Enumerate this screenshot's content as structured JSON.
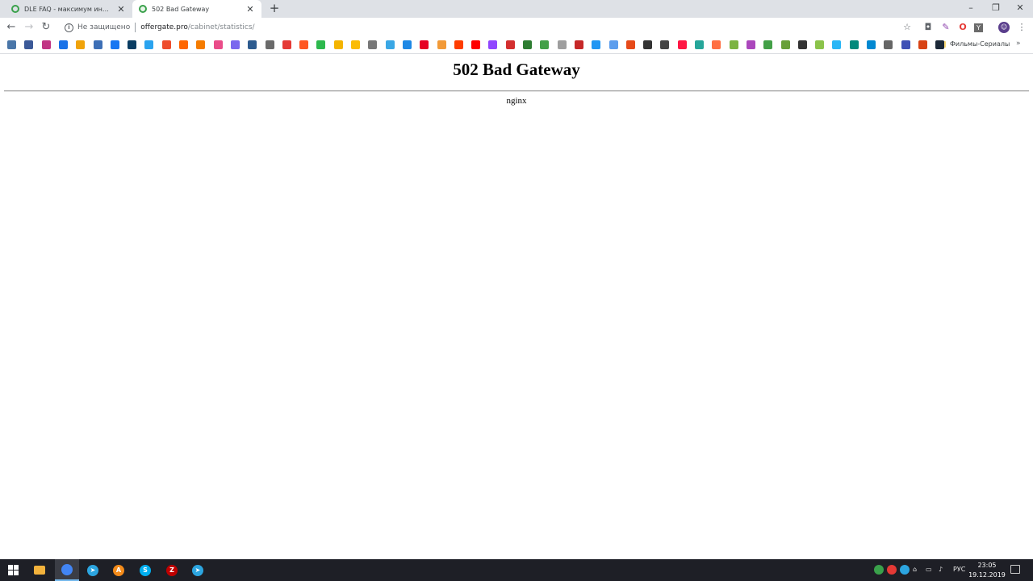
{
  "browser": {
    "tabs": [
      {
        "title": "DLE FAQ - максимум информа...",
        "close": "✕"
      },
      {
        "title": "502 Bad Gateway",
        "close": "✕"
      }
    ],
    "new_tab": "+",
    "window_controls": {
      "minimize": "–",
      "maximize": "❐",
      "close": "✕"
    },
    "nav": {
      "back": "←",
      "forward": "→",
      "reload": "↻"
    },
    "address": {
      "security_label": "Не защищено",
      "host": "offergate.pro",
      "path": "/cabinet/statistics/"
    },
    "toolbar_icons": [
      "bookmark-star-icon",
      "camera-icon",
      "pen-icon",
      "opera-icon",
      "yandex-icon",
      "profile-avatar-icon",
      "menu-kebab-icon"
    ],
    "bookmarks": {
      "icon_colors": [
        "#4a76a8",
        "#3b5998",
        "#c13584",
        "#1a73e8",
        "#f0a30a",
        "#3d6fb6",
        "#1877f2",
        "#0a3d62",
        "#2aa3ef",
        "#ee4d2d",
        "#ff6600",
        "#f57c00",
        "#ea4c89",
        "#7b68ee",
        "#2d5b8f",
        "#6a6a6a",
        "#e53935",
        "#ff5722",
        "#2db84d",
        "#f4b400",
        "#fbbc04",
        "#777777",
        "#3aa7e5",
        "#1e88e5",
        "#e60023",
        "#f29a38",
        "#ff3d00",
        "#ff0000",
        "#9146ff",
        "#d32f2f",
        "#2e7d32",
        "#43a047",
        "#9e9e9e",
        "#c62828",
        "#2196f3",
        "#5c9ded",
        "#e64a19",
        "#333333",
        "#444444",
        "#ff1744",
        "#26a69a",
        "#ff7043",
        "#7cb342",
        "#ab47bc",
        "#43a047",
        "#689f38",
        "#333333",
        "#8bc34a",
        "#29b6f6",
        "#00897b",
        "#0288d1",
        "#666666",
        "#3f51b5",
        "#d84315",
        "#1b2838"
      ],
      "folder_label": "Фильмы-Сериалы",
      "more": "»"
    }
  },
  "page": {
    "heading": "502 Bad Gateway",
    "server": "nginx"
  },
  "taskbar": {
    "apps": [
      {
        "name": "file-explorer",
        "color": "#f3b23c",
        "glyph": ""
      },
      {
        "name": "chrome",
        "color": "#4285f4",
        "glyph": ""
      },
      {
        "name": "telegram",
        "color": "#2ca5e0",
        "glyph": "➤"
      },
      {
        "name": "avast",
        "color": "#f48b1a",
        "glyph": "A"
      },
      {
        "name": "skype",
        "color": "#00aff0",
        "glyph": "S"
      },
      {
        "name": "filezilla",
        "color": "#bf0000",
        "glyph": "Z"
      },
      {
        "name": "telegram",
        "color": "#2ca5e0",
        "glyph": "➤"
      }
    ],
    "language": "РУС",
    "time": "23:05",
    "date": "19.12.2019"
  }
}
